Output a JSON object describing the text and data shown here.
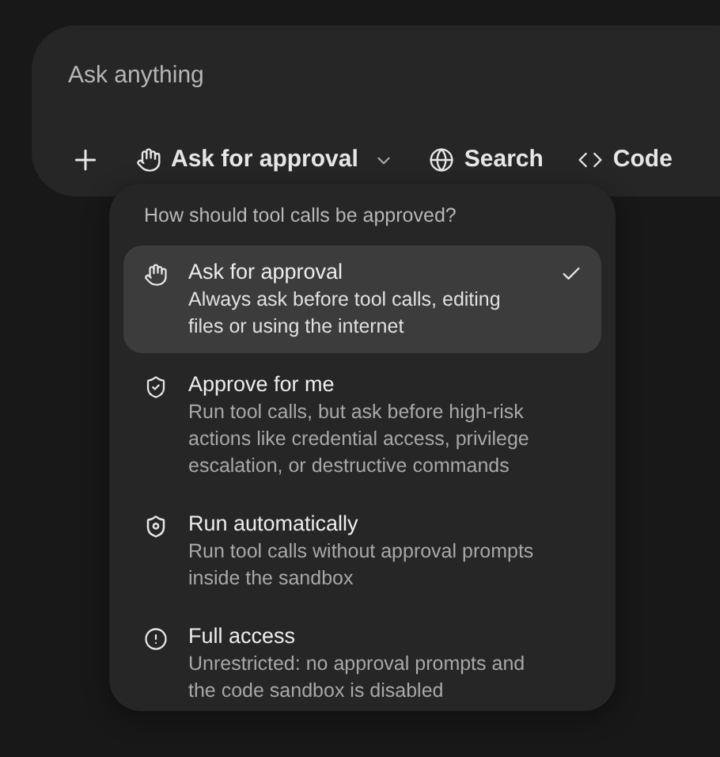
{
  "composer": {
    "placeholder": "Ask anything",
    "toolbar": [
      {
        "kind": "add"
      },
      {
        "kind": "mode",
        "label": "Ask for approval",
        "expanded": true
      },
      {
        "kind": "search",
        "label": "Search"
      },
      {
        "kind": "code",
        "label": "Code"
      }
    ]
  },
  "menu": {
    "heading": "How should tool calls be approved?",
    "options": [
      {
        "kind": "hand",
        "title": "Ask for approval",
        "description": "Always ask before tool calls, editing files or using the internet",
        "selected": true
      },
      {
        "kind": "shield-check",
        "title": "Approve for me",
        "description": "Run tool calls, but ask before high-risk actions like credential access, privilege escalation, or destructive commands",
        "selected": false
      },
      {
        "kind": "shield-dot",
        "title": "Run automatically",
        "description": "Run tool calls without approval prompts inside the sandbox",
        "selected": false
      },
      {
        "kind": "alert",
        "title": "Full access",
        "description": "Unrestricted: no approval prompts and the code sandbox is disabled",
        "selected": false
      }
    ]
  }
}
